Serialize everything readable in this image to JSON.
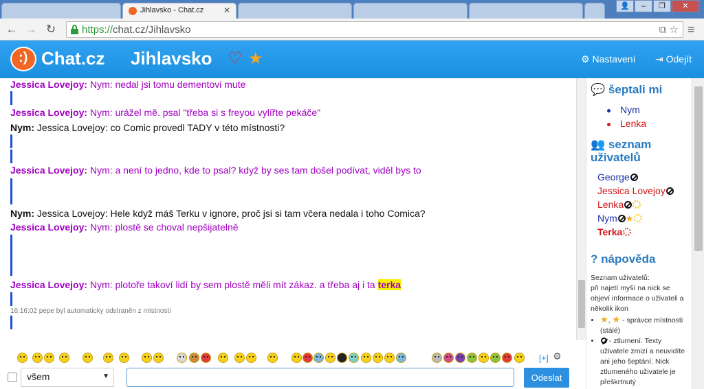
{
  "browser": {
    "active_tab_title": "Jihlavsko - Chat.cz",
    "url_scheme": "https://",
    "url_host": "chat.cz",
    "url_path": "/Jihlavsko"
  },
  "header": {
    "logo_text": "Chat.cz",
    "room_name": "Jihlavsko",
    "settings_label": "Nastavení",
    "logout_label": "Odejít"
  },
  "messages": [
    {
      "author": "Jessica Lovejoy:",
      "text": "Nym: nedal jsi tomu dementovi mute",
      "style": "purple"
    },
    {
      "author": "Jessica Lovejoy:",
      "text": "Nym: urážel mě. psal \"třeba si s freyou vylířte pekáče\"",
      "style": "purple"
    },
    {
      "author": "Nym:",
      "text": "Jessica Lovejoy: co Comic provedl TADY v této místnosti?",
      "style": "black"
    },
    {
      "author": "Jessica Lovejoy:",
      "text": "Nym: a není to jedno, kde to psal? když by ses tam došel podívat, viděl bys to",
      "style": "purple"
    },
    {
      "author": "Nym:",
      "text": "Jessica Lovejoy: Hele když máš Terku v ignore, proč jsi si tam včera nedala i toho Comica?",
      "style": "black"
    },
    {
      "author": "Jessica Lovejoy:",
      "text": "Nym: plostě se choval nepšijatelně",
      "style": "purple"
    },
    {
      "author": "Jessica Lovejoy:",
      "text": "Nym: plotoře takoví lidí by sem plostě měli mít zákaz. a třeba aj i ta",
      "style": "purple",
      "highlight": "terka"
    }
  ],
  "system_message": "16:16:02 pepe byl automaticky odstraněn z místnosti",
  "sidebar": {
    "whispers_title": "šeptali mi",
    "whispers": [
      {
        "name": "Nym",
        "color": "#1c2fa8"
      },
      {
        "name": "Lenka",
        "color": "#d21717"
      }
    ],
    "users_title": "seznam uživatelů",
    "users": [
      {
        "name": "George",
        "color": "#1c2fa8"
      },
      {
        "name": "Jessica Lovejoy",
        "color": "#d21717"
      },
      {
        "name": "Lenka",
        "color": "#d21717"
      },
      {
        "name": "Nym",
        "color": "#1c2fa8"
      },
      {
        "name": "Terka",
        "color": "#d21717"
      }
    ],
    "help_title": "nápověda",
    "help_intro": "Seznam uživatelů:",
    "help_text": "při najetí myší na nick se objeví informace o uživateli a několik ikon",
    "help_item_1": "- správce místnosti (stálé)",
    "help_item_2": "- ztlumení. Texty uživatele zmizí a neuvidíte ani jeho šeptání. Nick ztlumeného uživatele je přeškrtnutý"
  },
  "composer": {
    "recipient": "všem",
    "plus_label": "[+]",
    "send_label": "Odeslat"
  },
  "colors": {
    "header_blue": "#1c8ee0",
    "purple_text": "#a000c0",
    "brand_orange": "#f26522"
  }
}
